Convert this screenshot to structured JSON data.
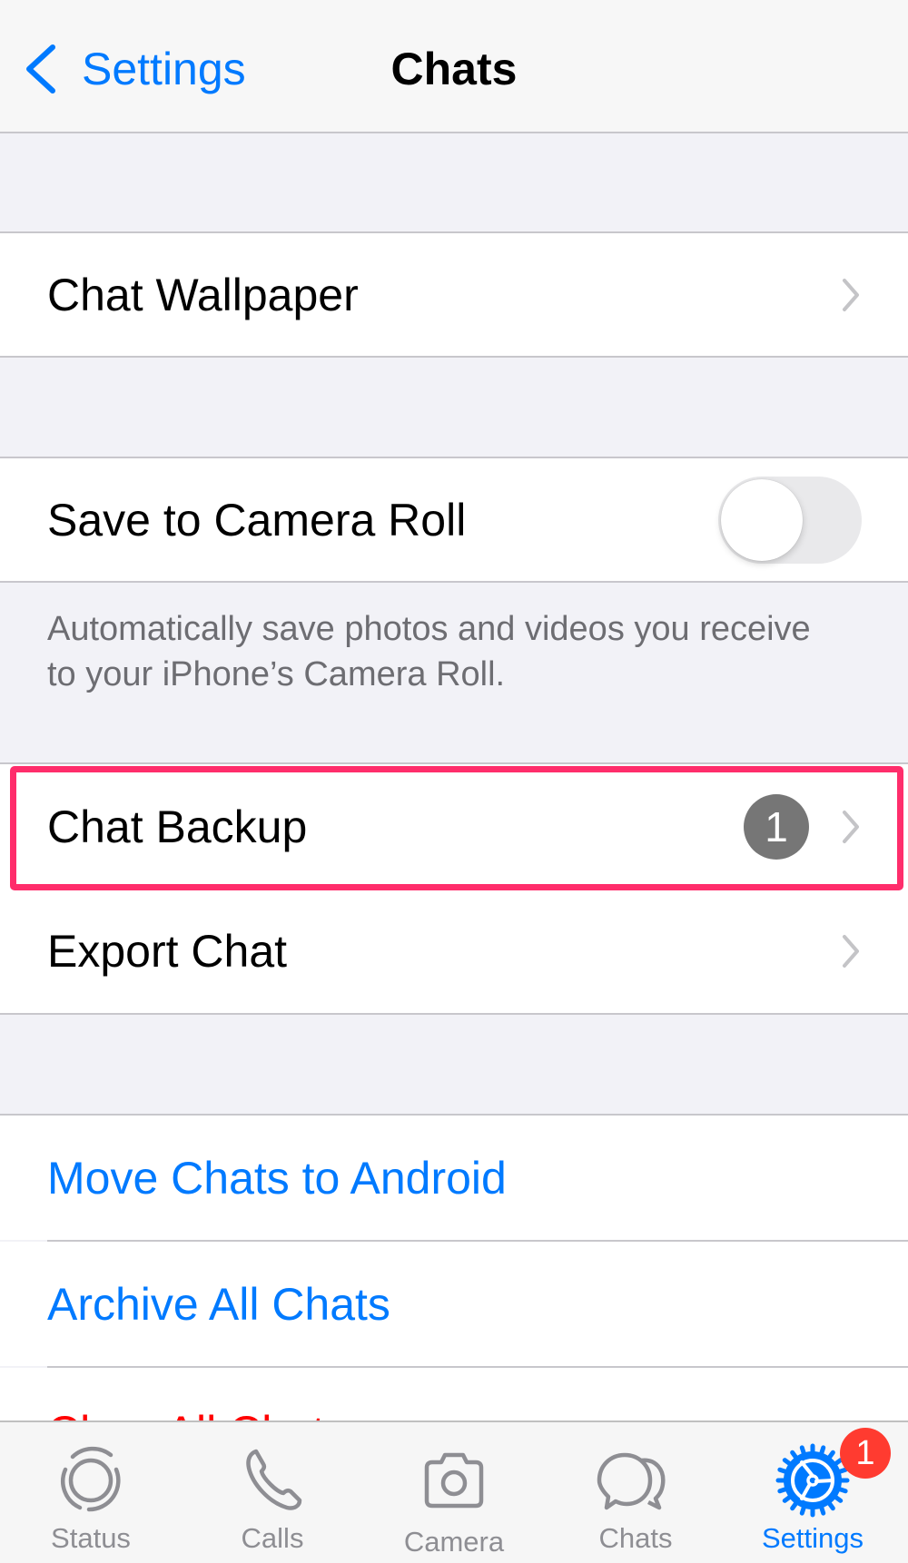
{
  "header": {
    "back_label": "Settings",
    "title": "Chats"
  },
  "sections": {
    "wallpaper": {
      "label": "Chat Wallpaper"
    },
    "camera_roll": {
      "label": "Save to Camera Roll",
      "toggle_on": false,
      "footer": "Automatically save photos and videos you receive to your iPhone’s Camera Roll."
    },
    "backup": {
      "label": "Chat Backup",
      "badge": "1",
      "highlighted": true,
      "highlight_color": "#ff2d6b"
    },
    "export": {
      "label": "Export Chat"
    },
    "actions": [
      {
        "label": "Move Chats to Android",
        "color": "#007aff"
      },
      {
        "label": "Archive All Chats",
        "color": "#007aff"
      },
      {
        "label": "Clear All Chats",
        "color": "#ff0000"
      }
    ]
  },
  "tabbar": {
    "tabs": [
      {
        "label": "Status",
        "icon": "status-icon",
        "active": false
      },
      {
        "label": "Calls",
        "icon": "phone-icon",
        "active": false
      },
      {
        "label": "Camera",
        "icon": "camera-icon",
        "active": false
      },
      {
        "label": "Chats",
        "icon": "chat-bubbles-icon",
        "active": false
      },
      {
        "label": "Settings",
        "icon": "gear-icon",
        "active": true
      }
    ],
    "settings_badge": "1"
  },
  "colors": {
    "accent": "#007aff",
    "destructive": "#ff0000",
    "badge_red": "#ff3b30",
    "inactive_tab": "#8e8e93"
  }
}
